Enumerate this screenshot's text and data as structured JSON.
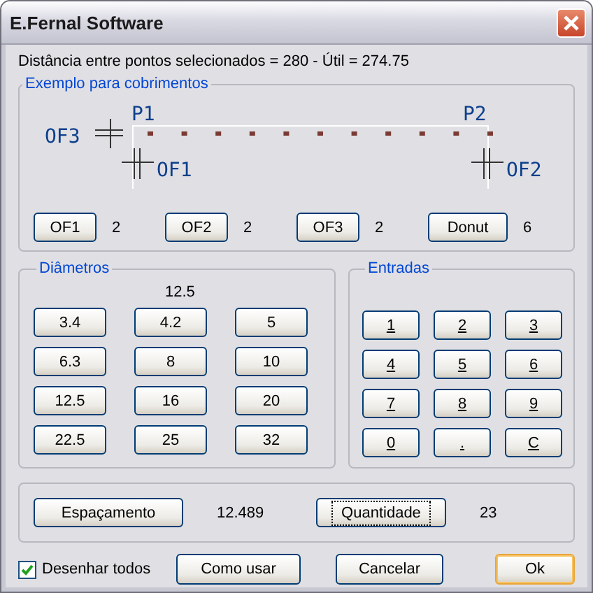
{
  "window": {
    "title": "E.Fernal Software"
  },
  "distance_text": "Distância entre pontos selecionados = 280 - Útil = 274.75",
  "example_group": {
    "title": "Exemplo para cobrimentos",
    "diagram_labels": {
      "of3": "OF3",
      "p1": "P1",
      "p2": "P2",
      "of1": "OF1",
      "of2": "OF2"
    },
    "offsets": [
      {
        "button": "OF1",
        "value": "2"
      },
      {
        "button": "OF2",
        "value": "2"
      },
      {
        "button": "OF3",
        "value": "2"
      },
      {
        "button": "Donut",
        "value": "6"
      }
    ]
  },
  "diameters_group": {
    "title": "Diâmetros",
    "current": "12.5",
    "buttons": [
      "3.4",
      "4.2",
      "5",
      "6.3",
      "8",
      "10",
      "12.5",
      "16",
      "20",
      "22.5",
      "25",
      "32"
    ]
  },
  "inputs_group": {
    "title": "Entradas",
    "keys": [
      "1",
      "2",
      "3",
      "4",
      "5",
      "6",
      "7",
      "8",
      "9",
      "0",
      ".",
      "C"
    ]
  },
  "result_group": {
    "items": [
      {
        "button": "Espaçamento",
        "value": "12.489",
        "focused": false
      },
      {
        "button": "Quantidade",
        "value": "23",
        "focused": true
      }
    ]
  },
  "draw_all": {
    "label": "Desenhar todos",
    "checked": true
  },
  "buttons": [
    {
      "label": "Como usar",
      "default": false
    },
    {
      "label": "Cancelar",
      "default": false
    },
    {
      "label": "Ok",
      "default": true
    }
  ]
}
